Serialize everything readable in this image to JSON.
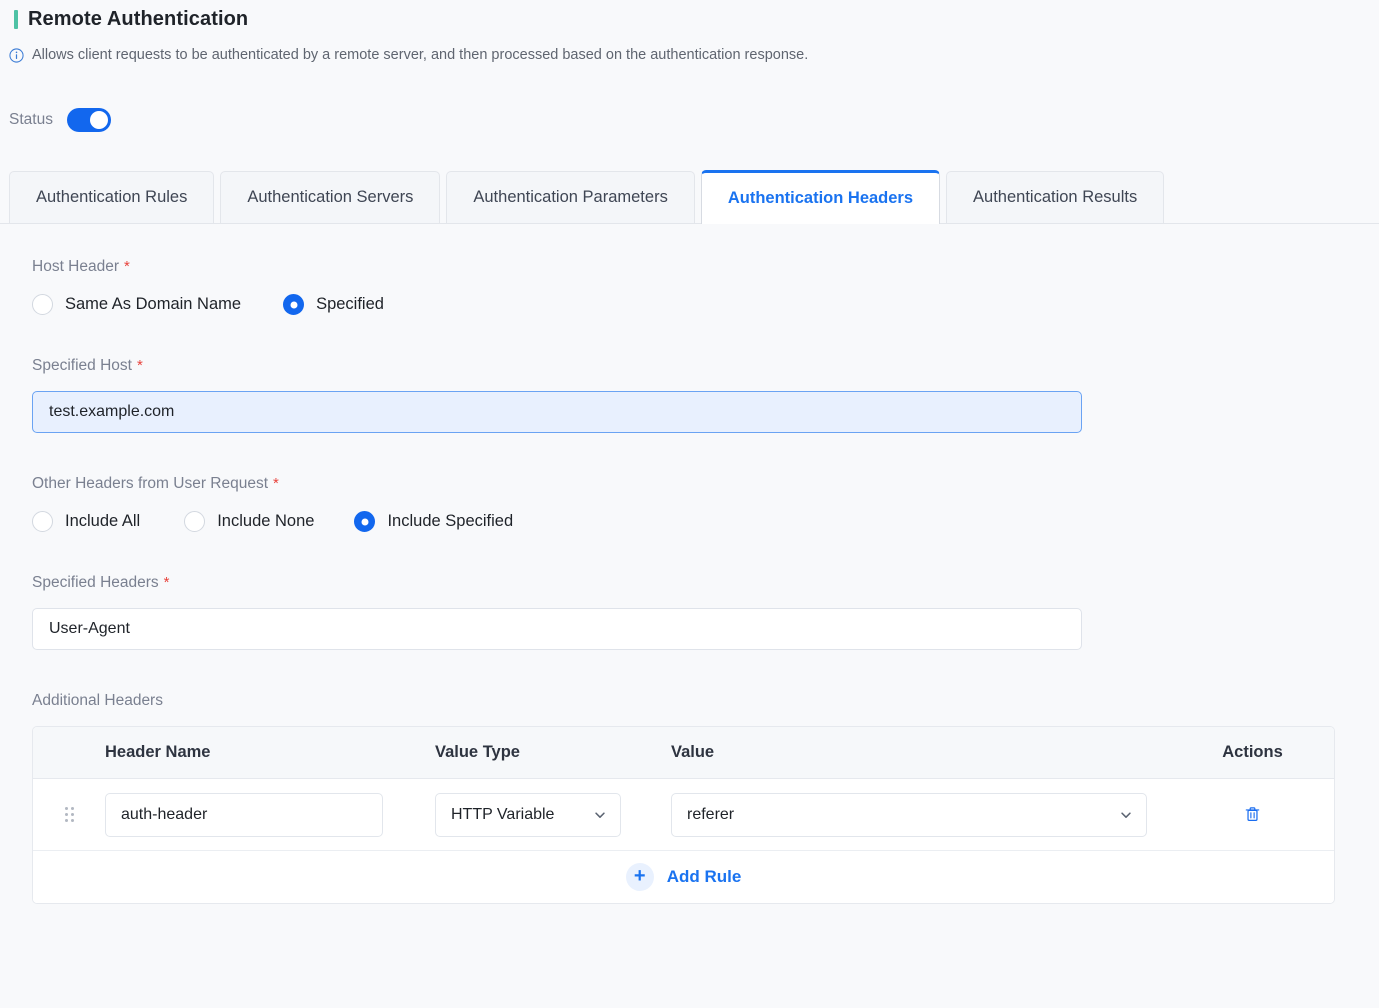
{
  "header": {
    "title": "Remote Authentication",
    "accent_color": "#4ec2a5",
    "info_icon": "info-circle-icon",
    "description": "Allows client requests to be authenticated by a remote server, and then processed based on the authentication response."
  },
  "status": {
    "label": "Status",
    "enabled": true,
    "accent_color": "#1267ee"
  },
  "tabs": [
    {
      "label": "Authentication Rules",
      "active": false
    },
    {
      "label": "Authentication Servers",
      "active": false
    },
    {
      "label": "Authentication Parameters",
      "active": false
    },
    {
      "label": "Authentication Headers",
      "active": true
    },
    {
      "label": "Authentication Results",
      "active": false
    }
  ],
  "host_header": {
    "label": "Host Header",
    "required_marker": "*",
    "options": [
      {
        "label": "Same As Domain Name",
        "selected": false
      },
      {
        "label": "Specified",
        "selected": true
      }
    ]
  },
  "specified_host": {
    "label": "Specified Host",
    "required_marker": "*",
    "value": "test.example.com",
    "placeholder": "Please enter",
    "focused": true
  },
  "other_headers": {
    "label": "Other Headers from User Request",
    "required_marker": "*",
    "options": [
      {
        "label": "Include All",
        "selected": false
      },
      {
        "label": "Include None",
        "selected": false
      },
      {
        "label": "Include Specified",
        "selected": true
      }
    ]
  },
  "specified_headers": {
    "label": "Specified Headers",
    "required_marker": "*",
    "value": "User-Agent",
    "placeholder": "Please enter"
  },
  "additional_headers": {
    "label": "Additional Headers",
    "columns": [
      "Header Name",
      "Value Type",
      "Value",
      "Actions"
    ],
    "rows": [
      {
        "drag_handle": "drag-handle-icon",
        "header_name": "auth-header",
        "value_type": "HTTP Variable",
        "value": "referer",
        "delete_icon": "trash-icon"
      }
    ],
    "add_button": {
      "label": "Add Rule",
      "icon": "plus-icon"
    }
  }
}
